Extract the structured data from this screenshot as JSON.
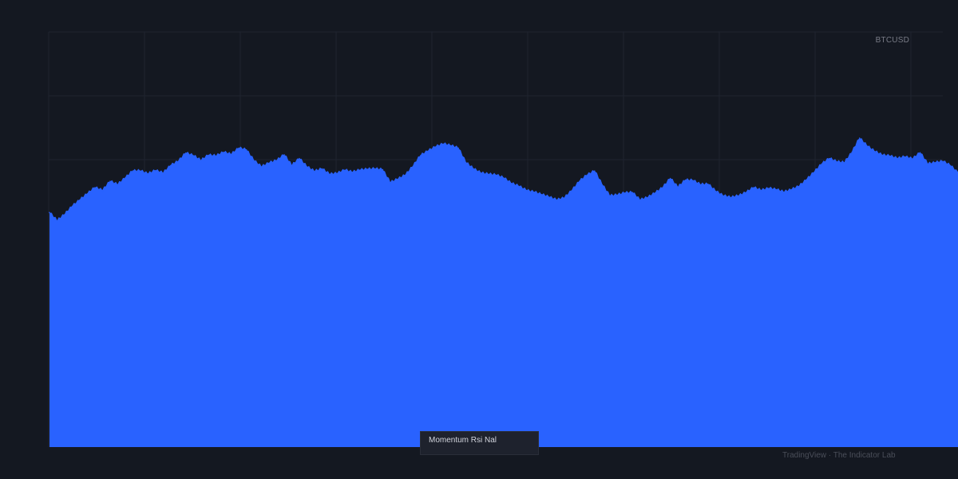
{
  "symbol": "BTCUSD",
  "indicator_label": "Momentum Rsi Nal",
  "watermark": "TradingView · The Indicator Lab",
  "colors": {
    "background": "#141821",
    "grid": "#1f2430",
    "area_fill": "#2962ff",
    "area_line": "#2962ff"
  },
  "chart_data": {
    "type": "area",
    "title": "",
    "xlabel": "",
    "ylabel": "",
    "grid": true,
    "legend": "none",
    "ylim": [
      0,
      100
    ],
    "series": [
      {
        "values": [
          56.5,
          54.5,
          56,
          58,
          59.5,
          61,
          62.5,
          61.8,
          64,
          63.2,
          64.8,
          66.5,
          66.5,
          65.8,
          66.6,
          66,
          67.8,
          68.8,
          70.8,
          70.2,
          69,
          70.3,
          70.1,
          71,
          70.5,
          72,
          71.6,
          69,
          67.5,
          68.4,
          69,
          70.4,
          67.8,
          69.5,
          67.5,
          66.4,
          67,
          65.7,
          65.9,
          66.7,
          66.2,
          66.7,
          66.9,
          67,
          66.8,
          63.7,
          64.5,
          65.5,
          67.6,
          70.2,
          71.3,
          72.3,
          73,
          72.6,
          72,
          68.5,
          67,
          66,
          65.7,
          65.5,
          64.8,
          63.5,
          62.8,
          61.8,
          61.4,
          60.8,
          60.2,
          59.5,
          60,
          61.8,
          64,
          65.5,
          66.5,
          63.2,
          60.5,
          60.7,
          61.2,
          61.3,
          59.5,
          60.1,
          61.2,
          62.5,
          64.7,
          62.6,
          64.3,
          64.2,
          63.2,
          63.3,
          61.6,
          60.5,
          60.1,
          60.5,
          61.3,
          62.5,
          61.8,
          62.3,
          62,
          61.4,
          62,
          62.8,
          64.4,
          66.2,
          68.2,
          69.5,
          68.7,
          68.5,
          71,
          74.4,
          72.5,
          71.2,
          70.3,
          70.1,
          69.5,
          69.9,
          69.4,
          70.9,
          68.2,
          68.5,
          68.8,
          67.8,
          66
        ]
      }
    ]
  }
}
